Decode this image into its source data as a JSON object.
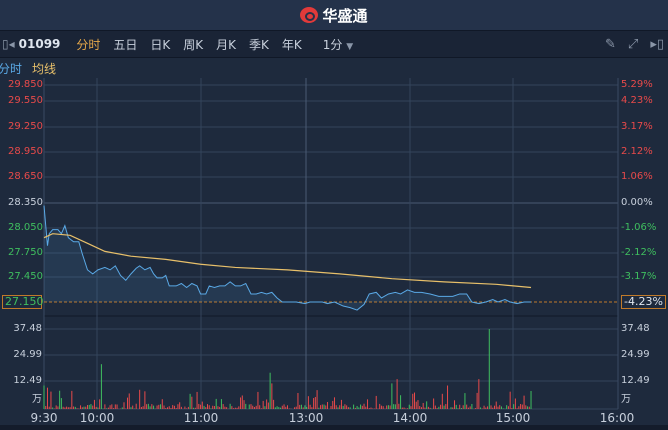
{
  "brand": {
    "name": "华盛通"
  },
  "toolbar": {
    "code": "01099",
    "tabs": [
      "分时",
      "五日",
      "日K",
      "周K",
      "月K",
      "季K",
      "年K"
    ],
    "active": "分时",
    "interval": "1分"
  },
  "legend": {
    "price": "分时",
    "avg": "均线"
  },
  "colors": {
    "price": "#5aa9e6",
    "avg": "#e8c06a",
    "up": "#e84a4a",
    "down": "#3fbf5f",
    "grid": "#34445c"
  },
  "price_axis": {
    "left": [
      "29.850",
      "29.550",
      "29.250",
      "28.950",
      "28.650",
      "28.350",
      "28.050",
      "27.750",
      "27.450",
      "27.150"
    ],
    "right": [
      "5.29%",
      "4.23%",
      "3.17%",
      "2.12%",
      "1.06%",
      "0.00%",
      "-1.06%",
      "-2.12%",
      "-3.17%",
      "-4.23%"
    ],
    "current": "27.150",
    "current_pct": "-4.23%",
    "prev_close": 28.35
  },
  "volume_axis": {
    "labels": [
      "37.48",
      "24.99",
      "12.49"
    ],
    "unit": "万",
    "max": 37.48
  },
  "time_axis": [
    "9:30",
    "10:00",
    "11:00",
    "13:00",
    "14:00",
    "15:00",
    "16:00"
  ],
  "chart_data": {
    "type": "line",
    "x_unit": "trading minutes from 9:30",
    "total_minutes": 330,
    "ylim": [
      27.15,
      29.85
    ],
    "price": [
      [
        0,
        28.35
      ],
      [
        1,
        28.1
      ],
      [
        2,
        27.85
      ],
      [
        3,
        28.0
      ],
      [
        5,
        28.05
      ],
      [
        8,
        28.05
      ],
      [
        10,
        28.0
      ],
      [
        12,
        28.1
      ],
      [
        14,
        27.95
      ],
      [
        17,
        27.9
      ],
      [
        20,
        27.9
      ],
      [
        22,
        27.75
      ],
      [
        25,
        27.55
      ],
      [
        28,
        27.5
      ],
      [
        31,
        27.55
      ],
      [
        35,
        27.58
      ],
      [
        38,
        27.55
      ],
      [
        41,
        27.6
      ],
      [
        44,
        27.48
      ],
      [
        47,
        27.42
      ],
      [
        50,
        27.5
      ],
      [
        53,
        27.57
      ],
      [
        55,
        27.6
      ],
      [
        58,
        27.55
      ],
      [
        61,
        27.58
      ],
      [
        63,
        27.5
      ],
      [
        65,
        27.45
      ],
      [
        68,
        27.45
      ],
      [
        70,
        27.48
      ],
      [
        72,
        27.35
      ],
      [
        76,
        27.35
      ],
      [
        79,
        27.38
      ],
      [
        82,
        27.33
      ],
      [
        85,
        27.38
      ],
      [
        88,
        27.35
      ],
      [
        90,
        27.25
      ],
      [
        93,
        27.25
      ],
      [
        95,
        27.35
      ],
      [
        98,
        27.33
      ],
      [
        101,
        27.35
      ],
      [
        104,
        27.35
      ],
      [
        107,
        27.4
      ],
      [
        110,
        27.35
      ],
      [
        113,
        27.35
      ],
      [
        116,
        27.38
      ],
      [
        119,
        27.25
      ],
      [
        122,
        27.25
      ],
      [
        125,
        27.27
      ],
      [
        128,
        27.25
      ],
      [
        131,
        27.27
      ],
      [
        134,
        27.2
      ],
      [
        137,
        27.15
      ],
      [
        145,
        27.15
      ],
      [
        150,
        27.13
      ],
      [
        153,
        27.15
      ],
      [
        160,
        27.15
      ],
      [
        163,
        27.13
      ],
      [
        167,
        27.15
      ],
      [
        172,
        27.1
      ],
      [
        176,
        27.08
      ],
      [
        180,
        27.05
      ],
      [
        184,
        27.12
      ],
      [
        187,
        27.25
      ],
      [
        191,
        27.27
      ],
      [
        194,
        27.2
      ],
      [
        198,
        27.25
      ],
      [
        202,
        27.27
      ],
      [
        205,
        27.25
      ],
      [
        209,
        27.3
      ],
      [
        213,
        27.27
      ],
      [
        217,
        27.27
      ],
      [
        222,
        27.25
      ],
      [
        227,
        27.22
      ],
      [
        235,
        27.22
      ],
      [
        239,
        27.25
      ],
      [
        243,
        27.25
      ],
      [
        246,
        27.15
      ],
      [
        250,
        27.13
      ],
      [
        254,
        27.15
      ],
      [
        258,
        27.18
      ],
      [
        261,
        27.15
      ],
      [
        265,
        27.18
      ],
      [
        268,
        27.15
      ],
      [
        272,
        27.13
      ],
      [
        276,
        27.15
      ],
      [
        280,
        27.15
      ]
    ],
    "avg": [
      [
        0,
        27.95
      ],
      [
        5,
        28.0
      ],
      [
        15,
        27.98
      ],
      [
        25,
        27.88
      ],
      [
        35,
        27.78
      ],
      [
        50,
        27.72
      ],
      [
        70,
        27.68
      ],
      [
        90,
        27.62
      ],
      [
        110,
        27.58
      ],
      [
        140,
        27.55
      ],
      [
        170,
        27.5
      ],
      [
        200,
        27.44
      ],
      [
        230,
        27.4
      ],
      [
        260,
        27.37
      ],
      [
        280,
        27.33
      ]
    ],
    "volume_spikes": [
      [
        0,
        11,
        "down"
      ],
      [
        2,
        10,
        "up"
      ],
      [
        33,
        21,
        "down"
      ],
      [
        55,
        9,
        "up"
      ],
      [
        88,
        8,
        "up"
      ],
      [
        123,
        8,
        "up"
      ],
      [
        130,
        17,
        "down"
      ],
      [
        131,
        12,
        "up"
      ],
      [
        152,
        6,
        "up"
      ],
      [
        200,
        12,
        "down"
      ],
      [
        203,
        14,
        "up"
      ],
      [
        250,
        14,
        "up"
      ],
      [
        256,
        37.48,
        "down"
      ],
      [
        232,
        11,
        "up"
      ]
    ]
  }
}
